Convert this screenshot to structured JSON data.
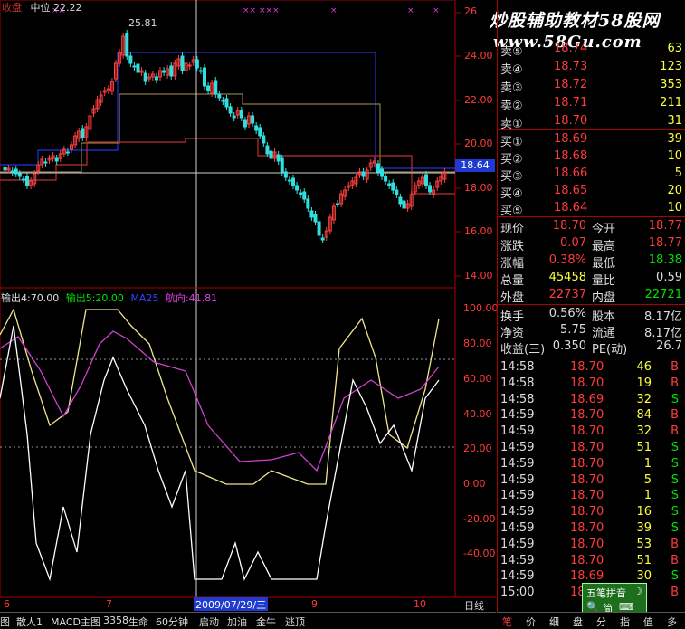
{
  "chart": {
    "top_legend": {
      "name_partial": "收盘",
      "pivot_label": "中位",
      "pivot_value": "22.22",
      "marker": "25.81"
    },
    "current_price_tag": "18.64",
    "price_axis_labels": [
      "26",
      "24.00",
      "22.00",
      "20.00",
      "18.00",
      "16.00",
      "14.00"
    ],
    "indicator_legend": {
      "out4_label": "输出4",
      "out4_value": "70.00",
      "out5_label": "输出5",
      "out5_value": "20.00",
      "ma_label": "MA25",
      "ma_value": "",
      "hang_label": "航向",
      "hang_value": "41.81"
    },
    "indicator_axis_labels": [
      "100.00",
      "80.00",
      "60.00",
      "40.00",
      "20.00",
      "0.00",
      "-20.00",
      "-40.00"
    ],
    "date_axis": {
      "labels": [
        "6",
        "7",
        "8",
        "9",
        "10"
      ],
      "cursor_date": "2009/07/29/三",
      "period": "日线"
    }
  },
  "watermark": {
    "line1": "炒股辅助教材58股网",
    "line2": "www.58Gu.com"
  },
  "order_book": {
    "sell": [
      {
        "label": "卖⑤",
        "price": "18.74",
        "vol": "63"
      },
      {
        "label": "卖④",
        "price": "18.73",
        "vol": "123"
      },
      {
        "label": "卖③",
        "price": "18.72",
        "vol": "353"
      },
      {
        "label": "卖②",
        "price": "18.71",
        "vol": "211"
      },
      {
        "label": "卖①",
        "price": "18.70",
        "vol": "31"
      }
    ],
    "buy": [
      {
        "label": "买①",
        "price": "18.69",
        "vol": "39"
      },
      {
        "label": "买②",
        "price": "18.68",
        "vol": "10"
      },
      {
        "label": "买③",
        "price": "18.66",
        "vol": "5"
      },
      {
        "label": "买④",
        "price": "18.65",
        "vol": "20"
      },
      {
        "label": "买⑤",
        "price": "18.64",
        "vol": "10"
      }
    ]
  },
  "stats": [
    {
      "l1": "现价",
      "v1": "18.70",
      "l2": "今开",
      "v2": "18.77"
    },
    {
      "l1": "涨跌",
      "v1": "0.07",
      "l2": "最高",
      "v2": "18.77"
    },
    {
      "l1": "涨幅",
      "v1": "0.38%",
      "l2": "最低",
      "v2": "18.38"
    },
    {
      "l1": "总量",
      "v1": "45458",
      "l2": "量比",
      "v2": "0.59"
    },
    {
      "l1": "外盘",
      "v1": "22737",
      "l2": "内盘",
      "v2": "22721"
    }
  ],
  "fundamentals": [
    {
      "l1": "换手",
      "v1": "0.56%",
      "l2": "股本",
      "v2": "8.17亿"
    },
    {
      "l1": "净资",
      "v1": "5.75",
      "l2": "流通",
      "v2": "8.17亿"
    },
    {
      "l1": "收益(三)",
      "v1": "0.350",
      "l2": "PE(动)",
      "v2": "26.7"
    }
  ],
  "ticks": [
    {
      "time": "14:58",
      "price": "18.70",
      "vol": "46",
      "side": "B"
    },
    {
      "time": "14:58",
      "price": "18.70",
      "vol": "19",
      "side": "B"
    },
    {
      "time": "14:58",
      "price": "18.69",
      "vol": "32",
      "side": "S"
    },
    {
      "time": "14:59",
      "price": "18.70",
      "vol": "84",
      "side": "B"
    },
    {
      "time": "14:59",
      "price": "18.70",
      "vol": "32",
      "side": "B"
    },
    {
      "time": "14:59",
      "price": "18.70",
      "vol": "51",
      "side": "S"
    },
    {
      "time": "14:59",
      "price": "18.70",
      "vol": "1",
      "side": "S"
    },
    {
      "time": "14:59",
      "price": "18.70",
      "vol": "5",
      "side": "S"
    },
    {
      "time": "14:59",
      "price": "18.70",
      "vol": "1",
      "side": "S"
    },
    {
      "time": "14:59",
      "price": "18.70",
      "vol": "16",
      "side": "S"
    },
    {
      "time": "14:59",
      "price": "18.70",
      "vol": "39",
      "side": "S"
    },
    {
      "time": "14:59",
      "price": "18.70",
      "vol": "53",
      "side": "B"
    },
    {
      "time": "14:59",
      "price": "18.70",
      "vol": "51",
      "side": "B"
    },
    {
      "time": "14:59",
      "price": "18.69",
      "vol": "30",
      "side": "S"
    },
    {
      "time": "15:00",
      "price": "18.70",
      "vol": "",
      "side": "B"
    }
  ],
  "bottom_bar": [
    "图",
    "散人1",
    "MACD主图",
    "3358",
    "生命",
    "60分钟",
    "启动",
    "加油",
    "金牛",
    "逃顶"
  ],
  "panel_tabs": [
    "笔",
    "价",
    "细",
    "盘",
    "分",
    "指",
    "值",
    "多"
  ],
  "ime": {
    "title": "五笔拼音",
    "mode": "简"
  }
}
